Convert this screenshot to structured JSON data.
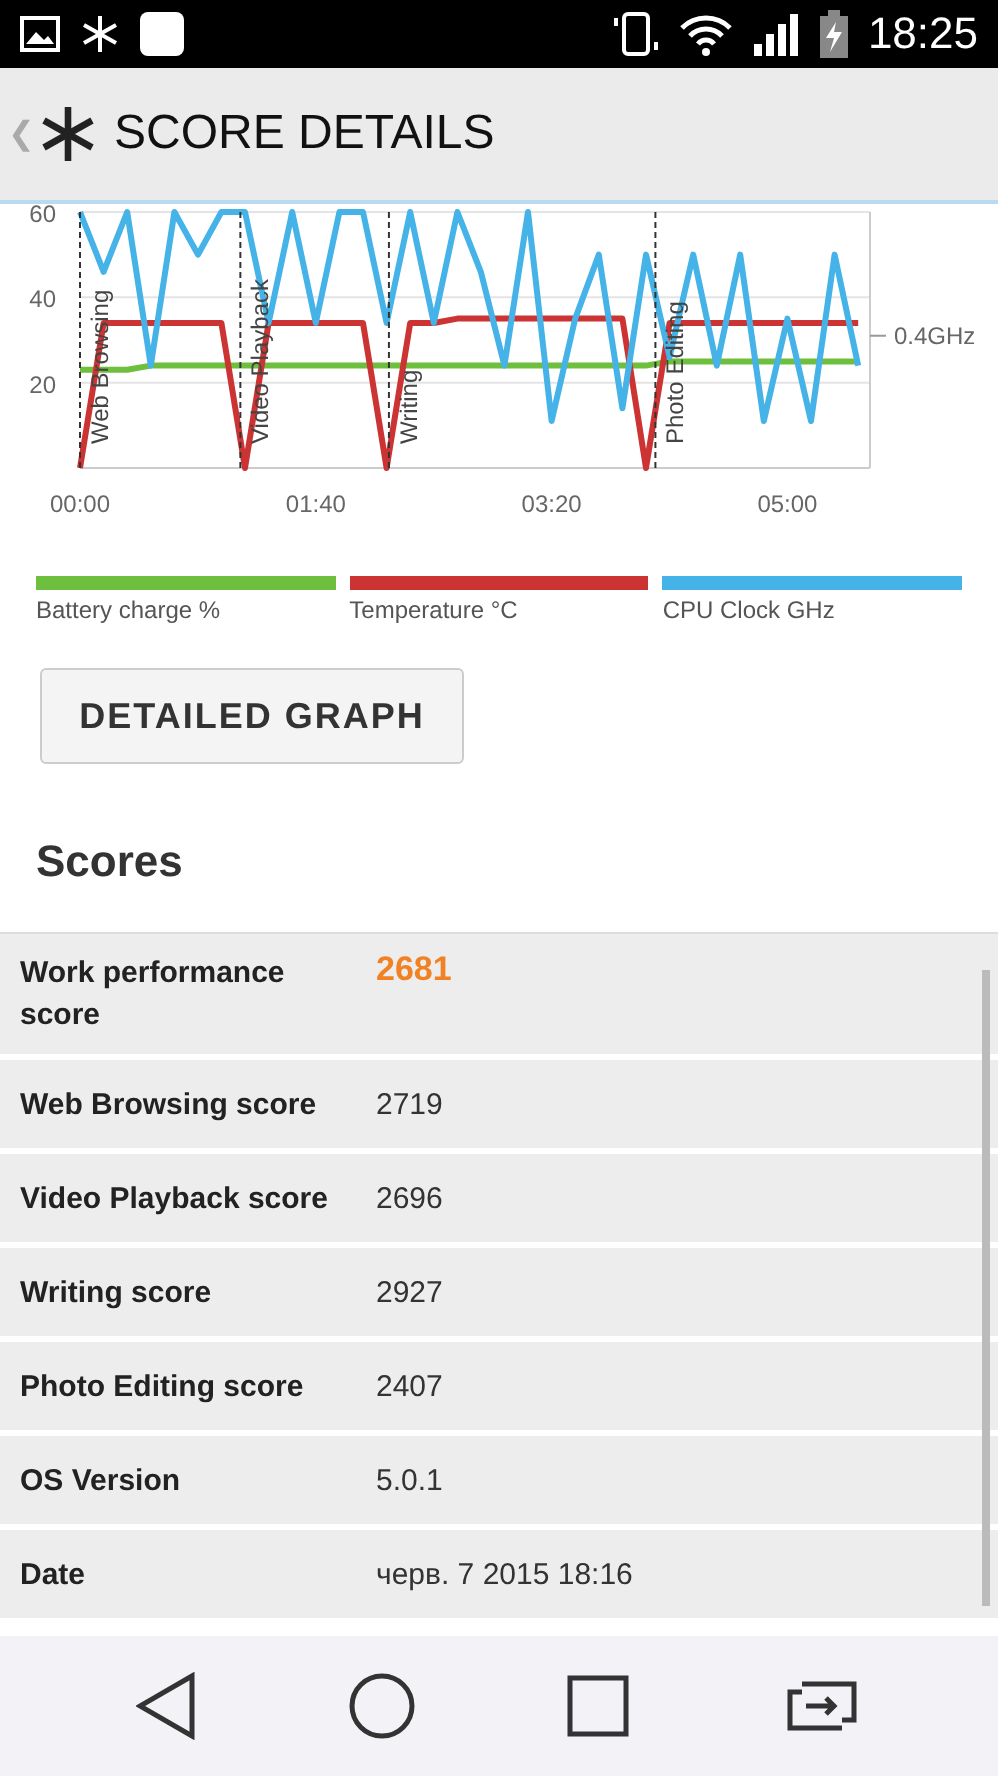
{
  "status_bar": {
    "time": "18:25"
  },
  "header": {
    "back": "❮",
    "title": "SCORE DETAILS"
  },
  "chart": {
    "chart_data": {
      "type": "line",
      "x": [
        0,
        10,
        20,
        30,
        40,
        50,
        60,
        70,
        80,
        90,
        100,
        110,
        120,
        130,
        140,
        150,
        160,
        170,
        180,
        190,
        200,
        210,
        220,
        230,
        240,
        250,
        260,
        270,
        280,
        290,
        300,
        310,
        320,
        330
      ],
      "series": [
        {
          "name": "Battery charge %",
          "color": "#6fbf3f",
          "values": [
            23,
            23,
            23,
            24,
            24,
            24,
            24,
            24,
            24,
            24,
            24,
            24,
            24,
            24,
            24,
            24,
            24,
            24,
            24,
            24,
            24,
            24,
            24,
            24,
            24,
            25,
            25,
            25,
            25,
            25,
            25,
            25,
            25,
            25
          ]
        },
        {
          "name": "Temperature °C",
          "color": "#cc3333",
          "values": [
            0,
            34,
            34,
            34,
            34,
            34,
            34,
            0,
            34,
            34,
            34,
            34,
            34,
            0,
            34,
            34,
            35,
            35,
            35,
            35,
            35,
            35,
            35,
            35,
            0,
            34,
            34,
            34,
            34,
            34,
            34,
            34,
            34,
            34
          ]
        },
        {
          "name": "CPU Clock GHz",
          "color": "#45b3e7",
          "values": [
            60,
            46,
            60,
            24,
            60,
            50,
            60,
            60,
            34,
            60,
            34,
            60,
            60,
            34,
            60,
            34,
            60,
            46,
            24,
            60,
            11,
            35,
            50,
            14,
            50,
            26,
            50,
            24,
            50,
            11,
            35,
            11,
            50,
            24
          ]
        }
      ],
      "xlim": [
        0,
        335
      ],
      "ylim": [
        0,
        60
      ],
      "xticks": [
        {
          "value": 0,
          "label": "00:00"
        },
        {
          "value": 100,
          "label": "01:40"
        },
        {
          "value": 200,
          "label": "03:20"
        },
        {
          "value": 300,
          "label": "05:00"
        }
      ],
      "yticks": [
        20,
        40,
        60
      ]
    },
    "phases": [
      {
        "label": "Web Browsing"
      },
      {
        "label": "Video Playback"
      },
      {
        "label": "Writing"
      },
      {
        "label": "Photo Editing"
      }
    ],
    "right_tick": {
      "label": "0.4GHz"
    }
  },
  "button": "DETAILED GRAPH",
  "scores_title": "Scores",
  "scores": [
    {
      "label": "Work performance score",
      "value": "2681",
      "highlight": true
    },
    {
      "label": "Web Browsing score",
      "value": "2719",
      "highlight": false
    },
    {
      "label": "Video Playback score",
      "value": "2696",
      "highlight": false
    },
    {
      "label": "Writing score",
      "value": "2927",
      "highlight": false
    },
    {
      "label": "Photo Editing score",
      "value": "2407",
      "highlight": false
    },
    {
      "label": "OS Version",
      "value": "5.0.1",
      "highlight": false
    },
    {
      "label": "Date",
      "value": "черв. 7 2015 18:16",
      "highlight": false
    }
  ]
}
